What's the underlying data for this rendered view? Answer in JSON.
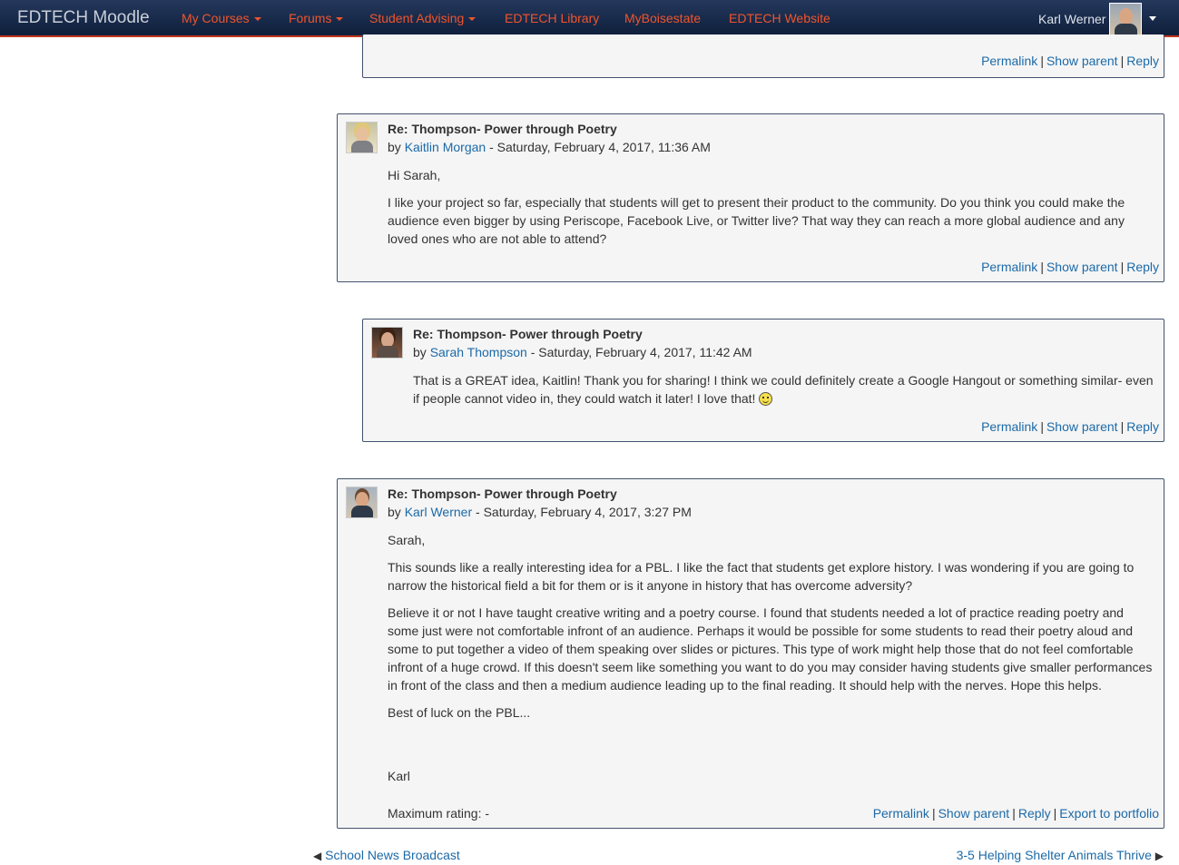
{
  "navbar": {
    "brand": "EDTECH Moodle",
    "items": [
      {
        "label": "My Courses",
        "dropdown": true
      },
      {
        "label": "Forums",
        "dropdown": true
      },
      {
        "label": "Student Advising",
        "dropdown": true
      },
      {
        "label": "EDTECH Library",
        "dropdown": false
      },
      {
        "label": "MyBoisestate",
        "dropdown": false
      },
      {
        "label": "EDTECH Website",
        "dropdown": false
      }
    ],
    "user_name": "Karl Werner",
    "accent_color": "#f0542d",
    "bar_color": "#1a2b4c"
  },
  "post_links": {
    "permalink": "Permalink",
    "show_parent": "Show parent",
    "reply": "Reply",
    "export": "Export to portfolio",
    "separator": "|",
    "by": "by",
    "dash": "-"
  },
  "posts": [
    {
      "subject": "Re: Thompson- Power through Poetry",
      "author": "Kaitlin Morgan",
      "date": "Saturday, February 4, 2017, 11:36 AM",
      "paragraphs": [
        "Hi Sarah,",
        "I like your project so far, especially that students will get to present their product to the community. Do you think you could make the audience even bigger by using Periscope, Facebook Live, or Twitter live? That way they can reach a more global audience and any loved ones who are not able to attend?"
      ]
    },
    {
      "subject": "Re: Thompson- Power through Poetry",
      "author": "Sarah Thompson",
      "date": "Saturday, February 4, 2017, 11:42 AM",
      "paragraphs": [
        "That is a GREAT idea, Kaitlin! Thank you for sharing! I think we could definitely create a Google Hangout or something similar- even if people cannot video in, they could watch it later! I love that!"
      ]
    },
    {
      "subject": "Re: Thompson- Power through Poetry",
      "author": "Karl Werner",
      "date": "Saturday, February 4, 2017, 3:27 PM",
      "paragraphs": [
        "Sarah,",
        "This sounds like a really interesting idea for a PBL. I like the fact that students get explore history. I was wondering if you are going to narrow the historical field a bit for them or is it anyone in history that has overcome adversity?",
        "Believe it or not I have taught creative writing and a poetry course. I found that students needed a lot of practice reading poetry and some just were not comfortable infront of an audience. Perhaps it would be possible for some students to read their poetry aloud and some to put together a video of them speaking over slides or pictures. This type of work might help those that do not feel comfortable infront of a huge crowd.  If this doesn't seem like something you want to do you may consider having students give smaller performances in front of the class and then a medium audience leading up to the final reading. It should help with the nerves. Hope this helps.",
        "Best of luck on the PBL...",
        "Karl"
      ],
      "rating": "Maximum rating: -"
    }
  ],
  "nav": {
    "prev": "School News Broadcast",
    "next": "3-5 Helping Shelter Animals Thrive"
  }
}
